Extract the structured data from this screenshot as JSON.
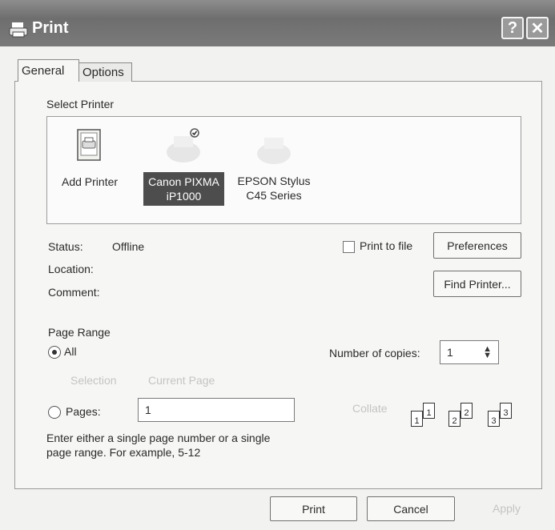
{
  "window": {
    "title": "Print",
    "help_label": "?",
    "close_label": "✕"
  },
  "tabs": [
    {
      "label": "General"
    },
    {
      "label": "Options"
    }
  ],
  "select_printer": {
    "heading": "Select Printer",
    "printers": [
      {
        "name_line1": "Add Printer",
        "name_line2": ""
      },
      {
        "name_line1": "Canon PIXMA",
        "name_line2": "iP1000",
        "selected": true,
        "default": true
      },
      {
        "name_line1": "EPSON Stylus",
        "name_line2": "C45 Series"
      }
    ]
  },
  "info": {
    "status_label": "Status:",
    "status_value": "Offline",
    "location_label": "Location:",
    "comment_label": "Comment:"
  },
  "print_to_file": {
    "label": "Print to file",
    "checked": false
  },
  "preferences_button": "Preferences",
  "find_printer_button": "Find Printer...",
  "page_range": {
    "heading": "Page Range",
    "all_label": "All",
    "selection_label": "Selection",
    "current_page_label": "Current Page",
    "pages_label": "Pages:",
    "pages_value": "1",
    "hint_line1": "Enter either a single page number or a single",
    "hint_line2": "page range.  For example, 5-12"
  },
  "copies": {
    "label": "Number of copies:",
    "value": "1",
    "collate_label": "Collate"
  },
  "collate_pages": [
    "1",
    "1",
    "2",
    "2",
    "3",
    "3"
  ],
  "footer": {
    "print_button": "Print",
    "cancel_button": "Cancel",
    "apply_button": "Apply"
  }
}
